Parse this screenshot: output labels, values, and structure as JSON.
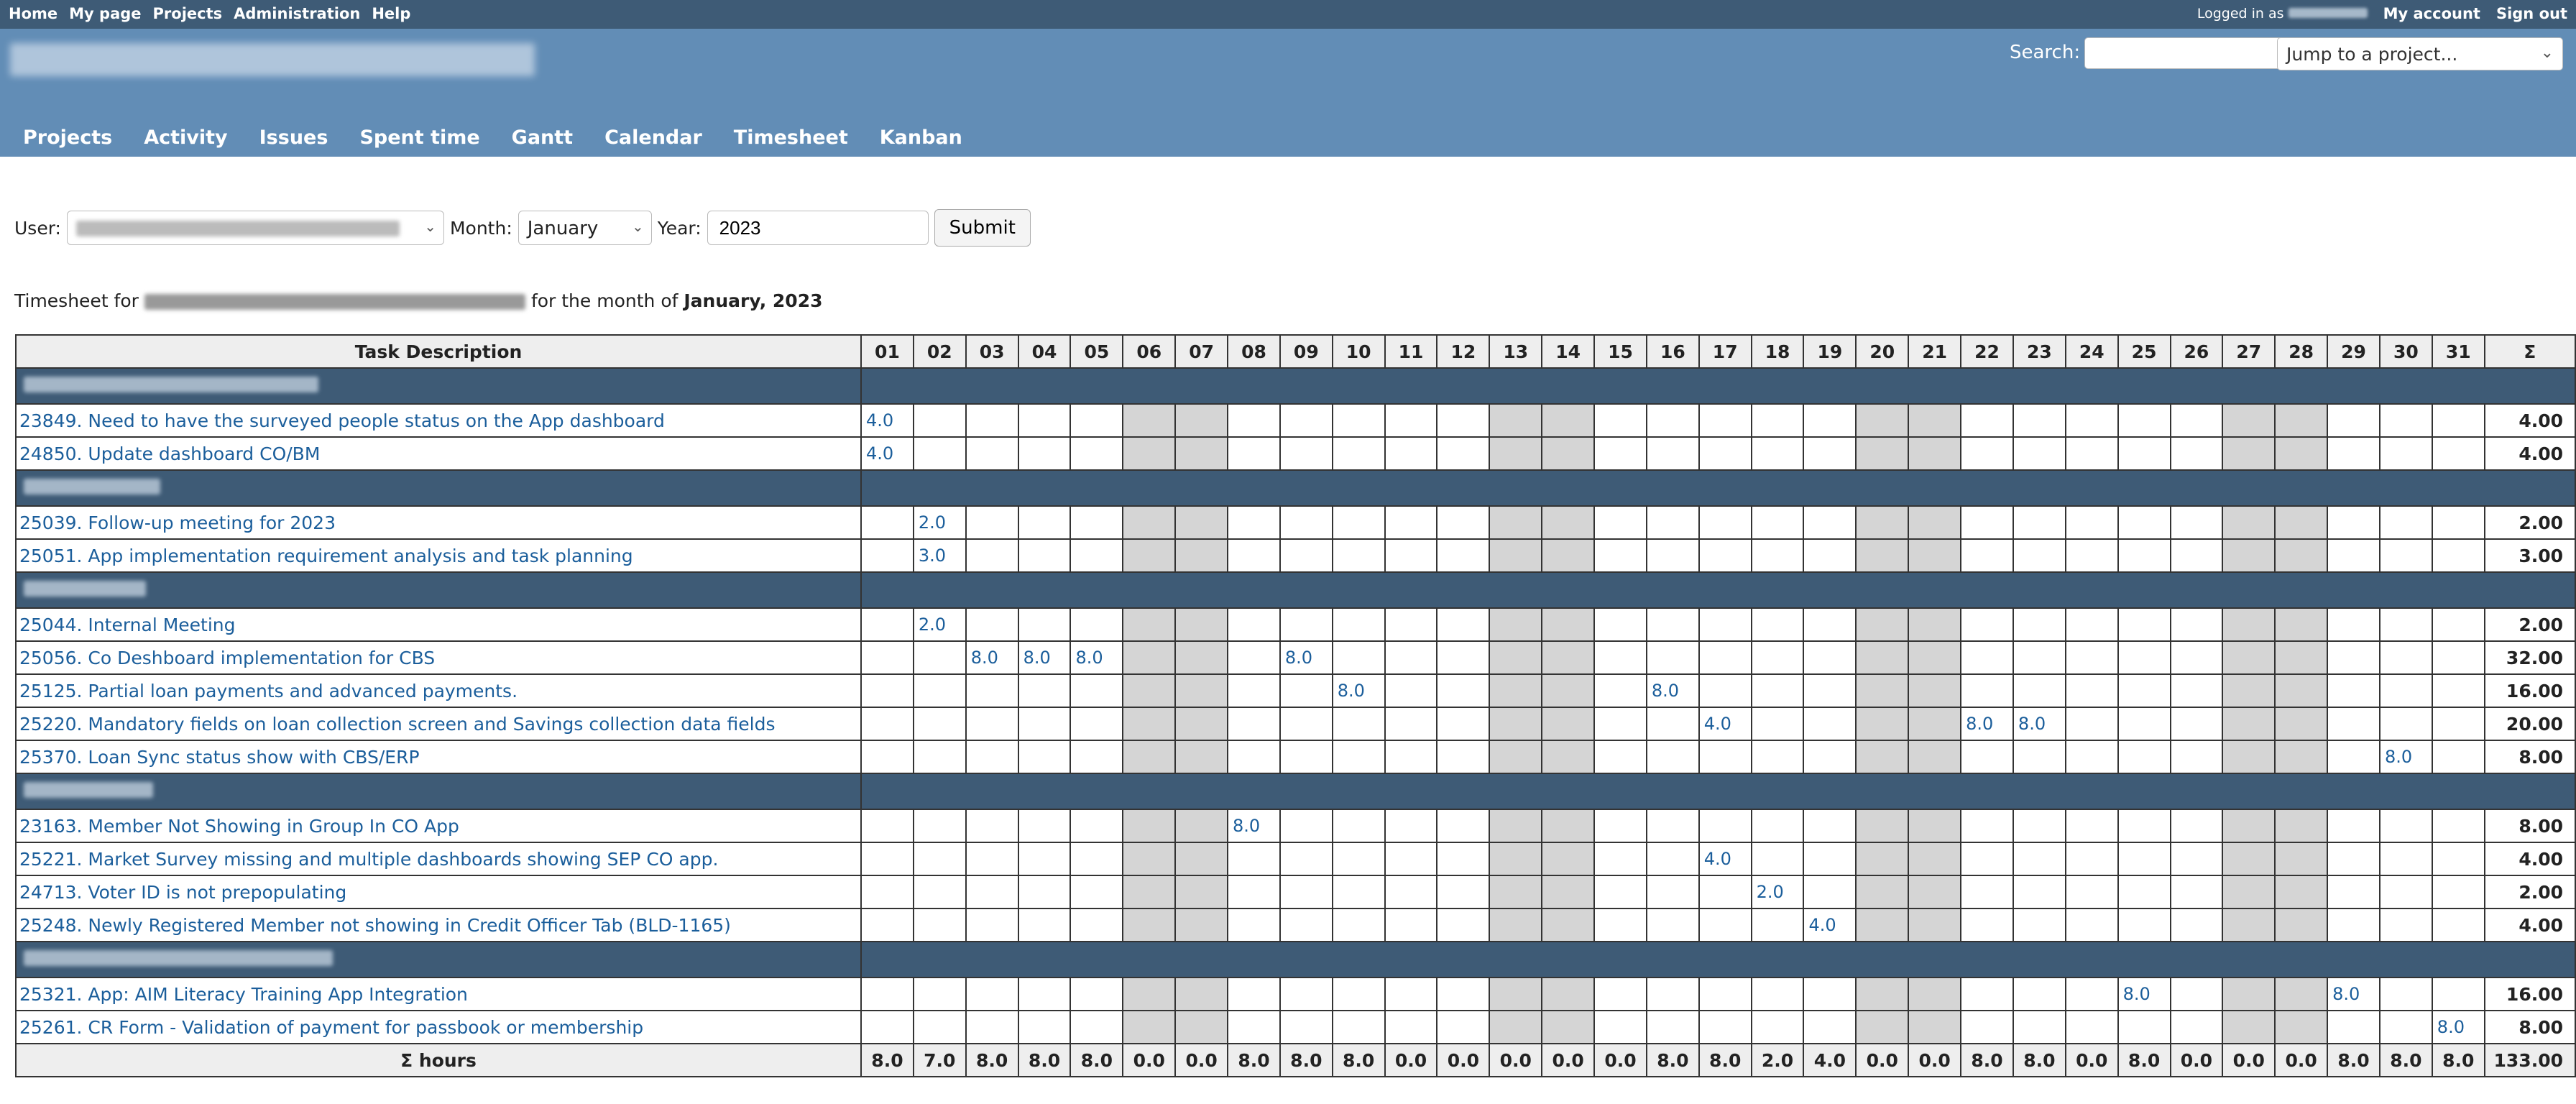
{
  "top_menu": {
    "items": [
      "Home",
      "My page",
      "Projects",
      "Administration",
      "Help"
    ],
    "logged_in_prefix": "Logged in as",
    "my_account": "My account",
    "sign_out": "Sign out"
  },
  "header": {
    "search_label": "Search:",
    "jump_placeholder": "Jump to a project..."
  },
  "main_menu": [
    "Projects",
    "Activity",
    "Issues",
    "Spent time",
    "Gantt",
    "Calendar",
    "Timesheet",
    "Kanban"
  ],
  "filter": {
    "user_label": "User:",
    "month_label": "Month:",
    "month_value": "January",
    "year_label": "Year:",
    "year_value": "2023",
    "submit_label": "Submit"
  },
  "timesheet_title": {
    "prefix": "Timesheet for",
    "middle": "for the month of",
    "period": "January, 2023"
  },
  "table": {
    "task_header": "Task Description",
    "sum_header": "Σ",
    "days": [
      "01",
      "02",
      "03",
      "04",
      "05",
      "06",
      "07",
      "08",
      "09",
      "10",
      "11",
      "12",
      "13",
      "14",
      "15",
      "16",
      "17",
      "18",
      "19",
      "20",
      "21",
      "22",
      "23",
      "24",
      "25",
      "26",
      "27",
      "28",
      "29",
      "30",
      "31"
    ],
    "weekend_days": [
      "06",
      "07",
      "13",
      "14",
      "20",
      "21",
      "27",
      "28"
    ],
    "rows": [
      {
        "type": "group"
      },
      {
        "type": "task",
        "desc": "23849. Need to have the surveyed people status on the App dashboard",
        "entries": {
          "01": "4.0"
        },
        "sum": "4.00"
      },
      {
        "type": "task",
        "desc": "24850. Update dashboard CO/BM",
        "entries": {
          "01": "4.0"
        },
        "sum": "4.00"
      },
      {
        "type": "group"
      },
      {
        "type": "task",
        "desc": "25039. Follow-up meeting for 2023",
        "entries": {
          "02": "2.0"
        },
        "sum": "2.00"
      },
      {
        "type": "task",
        "desc": "25051. App implementation requirement analysis and task planning",
        "entries": {
          "02": "3.0"
        },
        "sum": "3.00"
      },
      {
        "type": "group"
      },
      {
        "type": "task",
        "desc": "25044. Internal Meeting",
        "entries": {
          "02": "2.0"
        },
        "sum": "2.00"
      },
      {
        "type": "task",
        "desc": "25056. Co Deshboard implementation for CBS",
        "entries": {
          "03": "8.0",
          "04": "8.0",
          "05": "8.0",
          "09": "8.0"
        },
        "sum": "32.00"
      },
      {
        "type": "task",
        "desc": "25125. Partial loan payments and advanced payments.",
        "entries": {
          "10": "8.0",
          "16": "8.0"
        },
        "sum": "16.00"
      },
      {
        "type": "task",
        "desc": "25220. Mandatory fields on loan collection screen and Savings collection data fields",
        "entries": {
          "17": "4.0",
          "22": "8.0",
          "23": "8.0"
        },
        "sum": "20.00"
      },
      {
        "type": "task",
        "desc": "25370. Loan Sync status show with CBS/ERP",
        "entries": {
          "30": "8.0"
        },
        "sum": "8.00"
      },
      {
        "type": "group"
      },
      {
        "type": "task",
        "desc": "23163. Member Not Showing in Group In CO App",
        "entries": {
          "08": "8.0"
        },
        "sum": "8.00"
      },
      {
        "type": "task",
        "desc": "25221. Market Survey missing and multiple dashboards showing SEP CO app.",
        "entries": {
          "17": "4.0"
        },
        "sum": "4.00"
      },
      {
        "type": "task",
        "desc": "24713. Voter ID is not prepopulating",
        "entries": {
          "18": "2.0"
        },
        "sum": "2.00"
      },
      {
        "type": "task",
        "desc": "25248. Newly Registered Member not showing in Credit Officer Tab (BLD-1165)",
        "entries": {
          "19": "4.0"
        },
        "sum": "4.00"
      },
      {
        "type": "group"
      },
      {
        "type": "task",
        "desc": "25321. App: AIM Literacy Training App Integration",
        "entries": {
          "25": "8.0",
          "29": "8.0"
        },
        "sum": "16.00"
      },
      {
        "type": "task",
        "desc": "25261. CR Form - Validation of payment for passbook or membership",
        "entries": {
          "31": "8.0"
        },
        "sum": "8.00"
      }
    ],
    "totals_label": "Σ hours",
    "totals": [
      "8.0",
      "7.0",
      "8.0",
      "8.0",
      "8.0",
      "0.0",
      "0.0",
      "8.0",
      "8.0",
      "8.0",
      "0.0",
      "0.0",
      "0.0",
      "0.0",
      "0.0",
      "8.0",
      "8.0",
      "2.0",
      "4.0",
      "0.0",
      "0.0",
      "8.0",
      "8.0",
      "0.0",
      "8.0",
      "0.0",
      "0.0",
      "0.0",
      "8.0",
      "8.0",
      "8.0"
    ],
    "grand_total": "133.00"
  }
}
